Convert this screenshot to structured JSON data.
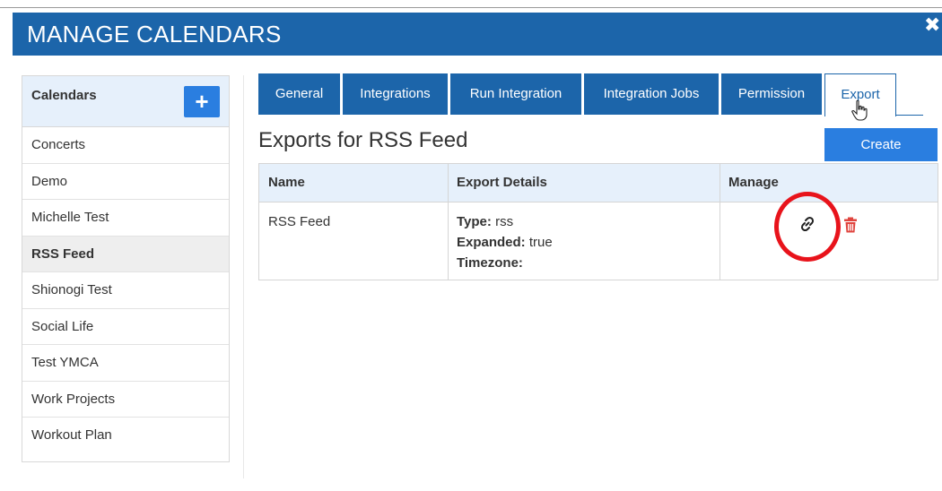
{
  "dialog": {
    "title": "MANAGE CALENDARS",
    "close_glyph": "✖"
  },
  "sidebar": {
    "title": "Calendars",
    "add_glyph": "+",
    "items": [
      {
        "label": "Concerts"
      },
      {
        "label": "Demo"
      },
      {
        "label": "Michelle Test"
      },
      {
        "label": "RSS Feed",
        "active": true
      },
      {
        "label": "Shionogi Test"
      },
      {
        "label": "Social Life"
      },
      {
        "label": "Test YMCA"
      },
      {
        "label": "Work Projects"
      },
      {
        "label": "Workout Plan"
      }
    ]
  },
  "tabs": [
    {
      "label": "General"
    },
    {
      "label": "Integrations"
    },
    {
      "label": "Run Integration"
    },
    {
      "label": "Integration Jobs"
    },
    {
      "label": "Permission"
    },
    {
      "label": "Export",
      "active": true
    }
  ],
  "main": {
    "section_title": "Exports for RSS Feed",
    "create_label": "Create",
    "table": {
      "headers": [
        "Name",
        "Export Details",
        "Manage"
      ],
      "rows": [
        {
          "name": "RSS Feed",
          "details": [
            {
              "key": "Type:",
              "value": " rss"
            },
            {
              "key": "Expanded:",
              "value": " true"
            },
            {
              "key": "Timezone:",
              "value": ""
            }
          ]
        }
      ]
    }
  },
  "colors": {
    "header_bg": "#1c65aa",
    "button_blue": "#2a7ee0",
    "highlight_ring": "#e8131b",
    "trash": "#e0443e"
  },
  "icons": [
    "close-icon",
    "plus-icon",
    "link-icon",
    "trash-icon",
    "hand-cursor-icon"
  ]
}
